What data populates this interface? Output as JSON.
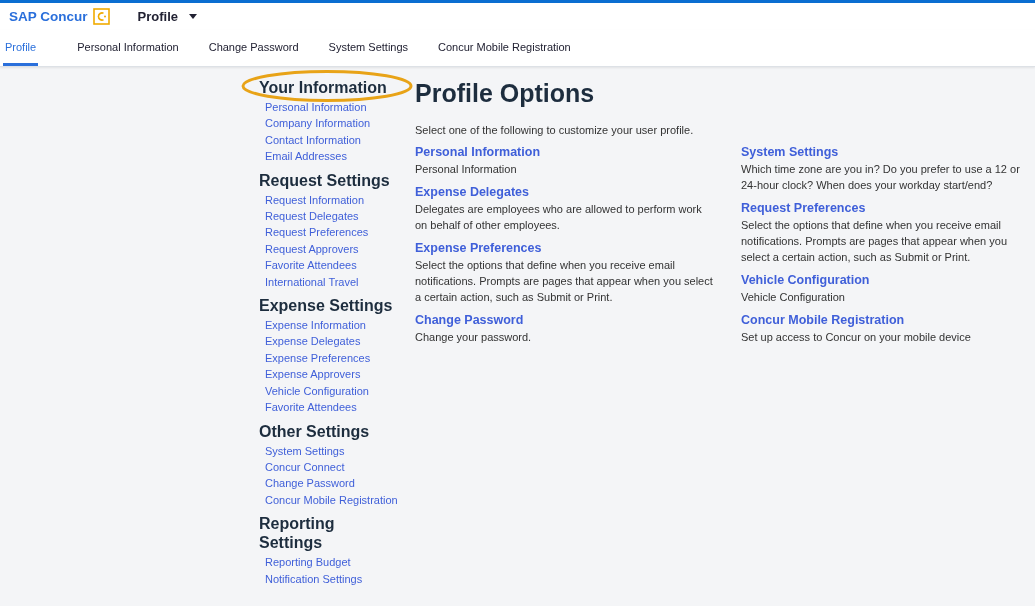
{
  "header": {
    "brand": "SAP Concur",
    "menu": "Profile"
  },
  "tabs": [
    {
      "label": "Profile",
      "selected": true
    },
    {
      "label": "Personal Information",
      "selected": false
    },
    {
      "label": "Change Password",
      "selected": false
    },
    {
      "label": "System Settings",
      "selected": false
    },
    {
      "label": "Concur Mobile Registration",
      "selected": false
    }
  ],
  "sidebar": {
    "sections": [
      {
        "title": "Your Information",
        "items": [
          "Personal Information",
          "Company Information",
          "Contact Information",
          "Email Addresses"
        ]
      },
      {
        "title": "Request Settings",
        "items": [
          "Request Information",
          "Request Delegates",
          "Request Preferences",
          "Request Approvers",
          "Favorite Attendees",
          "International Travel"
        ]
      },
      {
        "title": "Expense Settings",
        "items": [
          "Expense Information",
          "Expense Delegates",
          "Expense Preferences",
          "Expense Approvers",
          "Vehicle Configuration",
          "Favorite Attendees"
        ]
      },
      {
        "title": "Other Settings",
        "items": [
          "System Settings",
          "Concur Connect",
          "Change Password",
          "Concur Mobile Registration"
        ]
      },
      {
        "title": "Reporting Settings",
        "items": [
          "Reporting Budget",
          "Notification Settings"
        ]
      }
    ]
  },
  "main": {
    "title": "Profile Options",
    "intro": "Select one of the following to customize your user profile.",
    "columns": [
      [
        {
          "title": "Personal Information",
          "description": "Personal Information"
        },
        {
          "title": "Expense Delegates",
          "description": "Delegates are employees who are allowed to perform work on behalf of other employees."
        },
        {
          "title": "Expense Preferences",
          "description": "Select the options that define when you receive email notifications. Prompts are pages that appear when you select a certain action, such as Submit or Print."
        },
        {
          "title": "Change Password",
          "description": "Change your password."
        }
      ],
      [
        {
          "title": "System Settings",
          "description": "Which time zone are you in? Do you prefer to use a 12 or 24-hour clock? When does your workday start/end?"
        },
        {
          "title": "Request Preferences",
          "description": "Select the options that define when you receive email notifications. Prompts are pages that appear when you select a certain action, such as Submit or Print."
        },
        {
          "title": "Vehicle Configuration",
          "description": "Vehicle Configuration"
        },
        {
          "title": "Concur Mobile Registration",
          "description": "Set up access to Concur on your mobile device"
        }
      ]
    ]
  },
  "annotation": {
    "kind": "ellipse"
  }
}
